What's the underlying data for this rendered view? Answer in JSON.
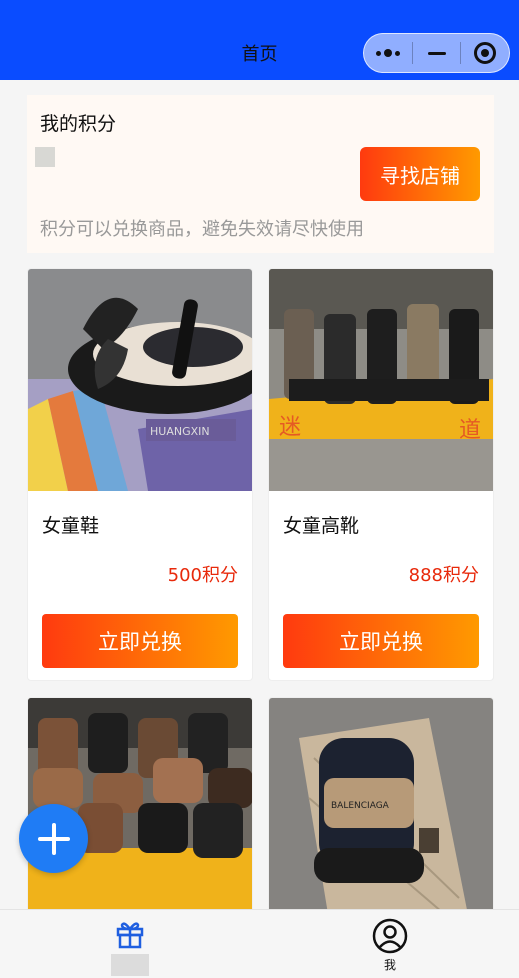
{
  "navbar": {
    "title": "首页",
    "bg_color": "#0a4cff",
    "capsule": {
      "more_icon": "more-dots-icon",
      "minimize_icon": "minus-icon",
      "close_icon": "target-circle-icon"
    }
  },
  "points": {
    "title": "我的积分",
    "find_store_label": "寻找店铺",
    "tip": "积分可以兑换商品，避免失效请尽快使用"
  },
  "products": [
    {
      "name": "女童鞋",
      "price": "500积分",
      "button": "立即兑换"
    },
    {
      "name": "女童高靴",
      "price": "888积分",
      "button": "立即兑换"
    },
    {
      "name": "",
      "price": "",
      "button": ""
    },
    {
      "name": "",
      "price": "",
      "button": ""
    }
  ],
  "fab": {
    "icon": "plus-icon"
  },
  "tabbar": {
    "items": [
      {
        "icon": "gift-icon",
        "label": "",
        "active": true
      },
      {
        "icon": "user-icon",
        "label": "我",
        "active": false
      }
    ]
  },
  "colors": {
    "accent_start": "#ff3a0f",
    "accent_end": "#ff9a00",
    "price": "#e8290b",
    "primary_blue": "#1f7cf5"
  }
}
